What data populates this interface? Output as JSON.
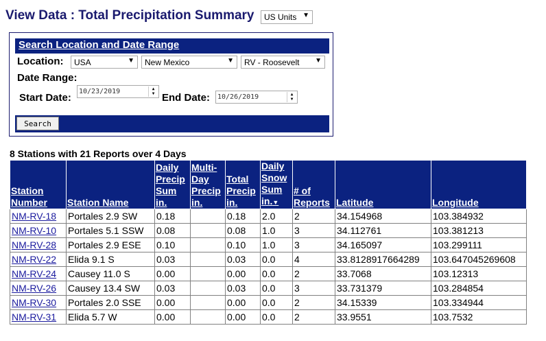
{
  "header": {
    "title": "View Data : Total Precipitation Summary",
    "units_select": "US Units"
  },
  "search": {
    "header": "Search Location and Date Range",
    "location_label": "Location:",
    "country": "USA",
    "state": "New Mexico",
    "county": "RV - Roosevelt",
    "date_range_label": "Date Range:",
    "start_label": "Start Date:",
    "start_value": "10/23/2019",
    "end_label": "End Date:",
    "end_value": "10/26/2019",
    "button": "Search"
  },
  "summary": "8 Stations with 21 Reports over 4 Days",
  "table": {
    "headers": {
      "station_number": [
        "Station",
        "Number"
      ],
      "station_name": "Station Name",
      "daily_precip": [
        "Daily",
        "Precip",
        "Sum",
        "in."
      ],
      "multi_day": [
        "Multi-",
        "Day",
        "Precip",
        "in."
      ],
      "total_precip": [
        "Total",
        "Precip",
        "in."
      ],
      "daily_snow": [
        "Daily",
        "Snow",
        "Sum",
        "in."
      ],
      "reports": [
        "# of",
        "Reports"
      ],
      "latitude": "Latitude",
      "longitude": "Longitude"
    },
    "rows": [
      {
        "num": "NM-RV-18",
        "name": "Portales 2.9 SW",
        "daily": "0.18",
        "multi": "",
        "total": "0.18",
        "snow": "2.0",
        "reports": "2",
        "lat": "34.154968",
        "lon": "103.384932"
      },
      {
        "num": "NM-RV-10",
        "name": "Portales 5.1 SSW",
        "daily": "0.08",
        "multi": "",
        "total": "0.08",
        "snow": "1.0",
        "reports": "3",
        "lat": "34.112761",
        "lon": "103.381213"
      },
      {
        "num": "NM-RV-28",
        "name": "Portales 2.9 ESE",
        "daily": "0.10",
        "multi": "",
        "total": "0.10",
        "snow": "1.0",
        "reports": "3",
        "lat": "34.165097",
        "lon": "103.299111"
      },
      {
        "num": "NM-RV-22",
        "name": "Elida 9.1 S",
        "daily": "0.03",
        "multi": "",
        "total": "0.03",
        "snow": "0.0",
        "reports": "4",
        "lat": "33.8128917664289",
        "lon": "103.647045269608"
      },
      {
        "num": "NM-RV-24",
        "name": "Causey 11.0 S",
        "daily": "0.00",
        "multi": "",
        "total": "0.00",
        "snow": "0.0",
        "reports": "2",
        "lat": "33.7068",
        "lon": "103.12313"
      },
      {
        "num": "NM-RV-26",
        "name": "Causey 13.4 SW",
        "daily": "0.03",
        "multi": "",
        "total": "0.03",
        "snow": "0.0",
        "reports": "3",
        "lat": "33.731379",
        "lon": "103.284854"
      },
      {
        "num": "NM-RV-30",
        "name": "Portales 2.0 SSE",
        "daily": "0.00",
        "multi": "",
        "total": "0.00",
        "snow": "0.0",
        "reports": "2",
        "lat": "34.15339",
        "lon": "103.334944"
      },
      {
        "num": "NM-RV-31",
        "name": "Elida 5.7 W",
        "daily": "0.00",
        "multi": "",
        "total": "0.00",
        "snow": "0.0",
        "reports": "2",
        "lat": "33.9551",
        "lon": "103.7532"
      }
    ]
  },
  "colors": {
    "header_bg": "#0b2280",
    "title_text": "#1a1a6e",
    "link": "#1a1a9e"
  }
}
